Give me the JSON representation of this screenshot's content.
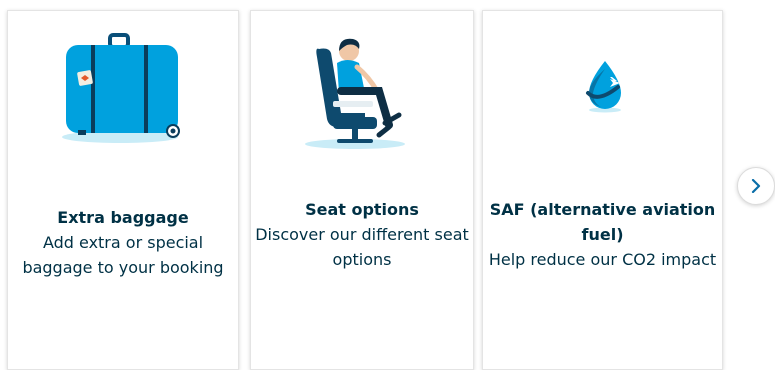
{
  "cards": [
    {
      "title": "Extra baggage",
      "desc": "Add extra or special baggage to your booking",
      "icon": "suitcase-icon"
    },
    {
      "title": "Seat options",
      "desc": "Discover our different seat options",
      "icon": "seated-passenger-icon"
    },
    {
      "title": "SAF (alternative aviation fuel)",
      "desc": "Help reduce our CO2 impact",
      "icon": "fuel-drop-plane-icon"
    }
  ],
  "carousel": {
    "next_icon": "chevron-right-icon"
  },
  "colors": {
    "text": "#003145",
    "brand_blue": "#00a1de",
    "dark_blue": "#0e4a6e",
    "shadow": "#c9ecf7"
  }
}
